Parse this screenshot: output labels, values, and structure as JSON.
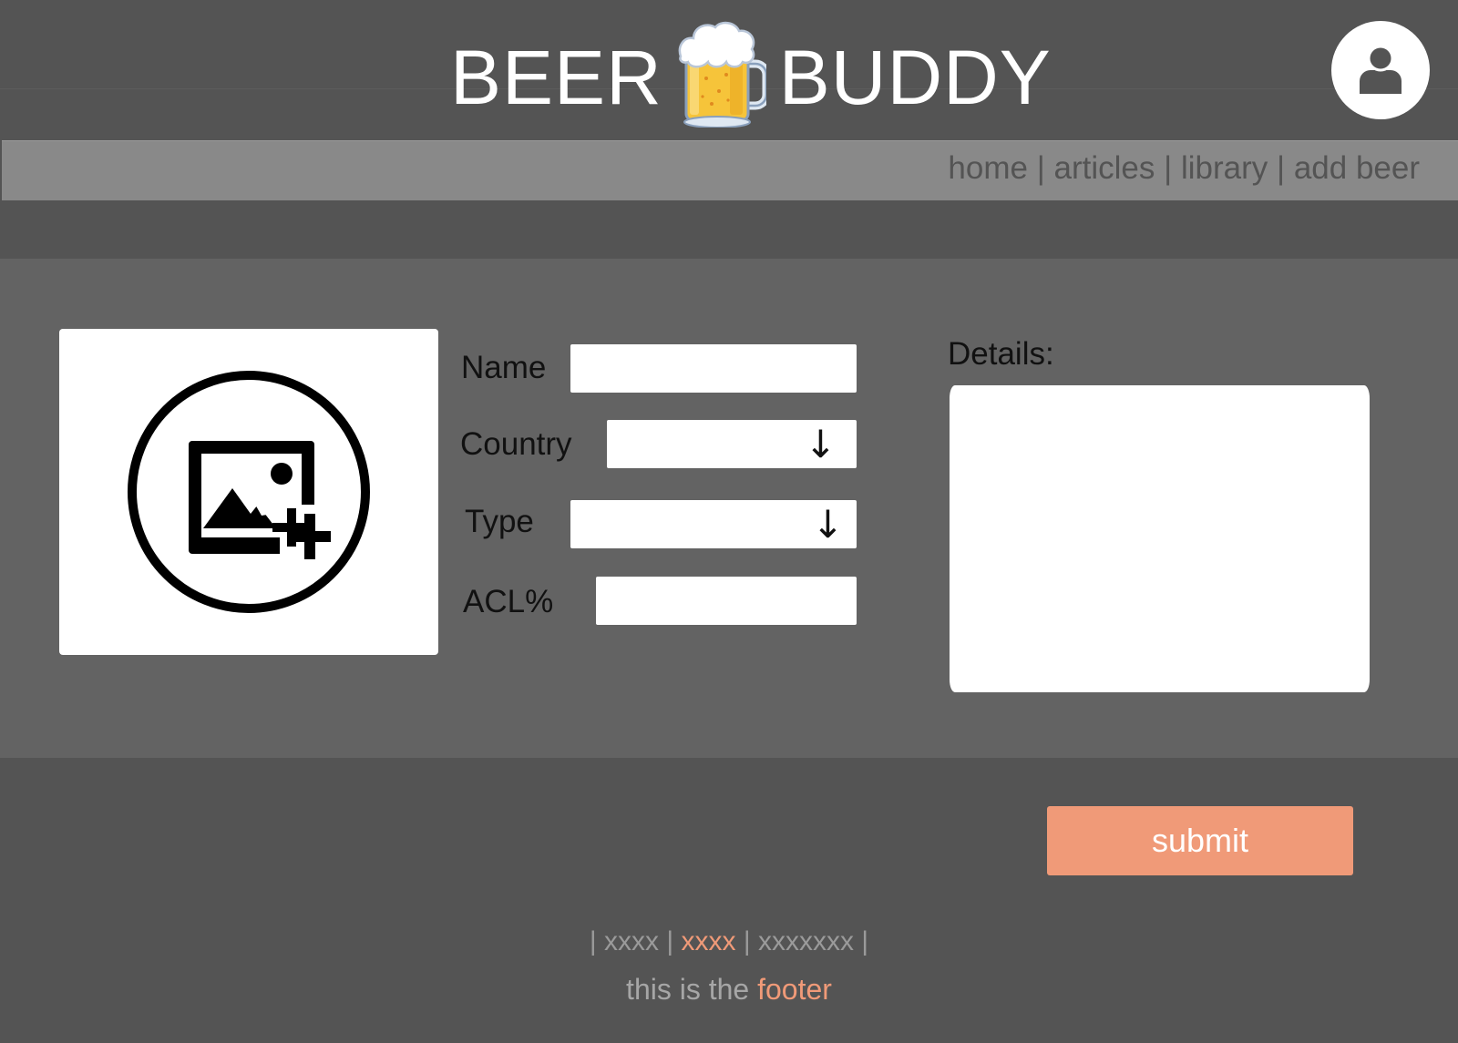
{
  "colors": {
    "background": "#545454",
    "panel": "#636363",
    "nav_bar": "#898989",
    "accent": "#f09a78",
    "field": "#ffffff"
  },
  "header": {
    "brand_left": "BEER",
    "brand_right": "BUDDY",
    "logo_icon": "beer-mug-icon",
    "profile_icon": "user-icon"
  },
  "nav": {
    "items": [
      "home",
      "articles",
      "library",
      "add beer"
    ]
  },
  "form": {
    "upload_icon": "add-image-icon",
    "name_label": "Name",
    "name_value": "",
    "country_label": "Country",
    "country_value": "",
    "type_label": "Type",
    "type_value": "",
    "dropdown_arrow": "↓",
    "acl_label": "ACL%",
    "acl_value": "",
    "details_label": "Details:",
    "details_value": ""
  },
  "actions": {
    "submit_label": "submit"
  },
  "footer": {
    "links": [
      "xxxx",
      "xxxx",
      "xxxxxxx"
    ],
    "active_link_index": 1,
    "text_prefix": "this is the",
    "text_highlight": "footer"
  }
}
